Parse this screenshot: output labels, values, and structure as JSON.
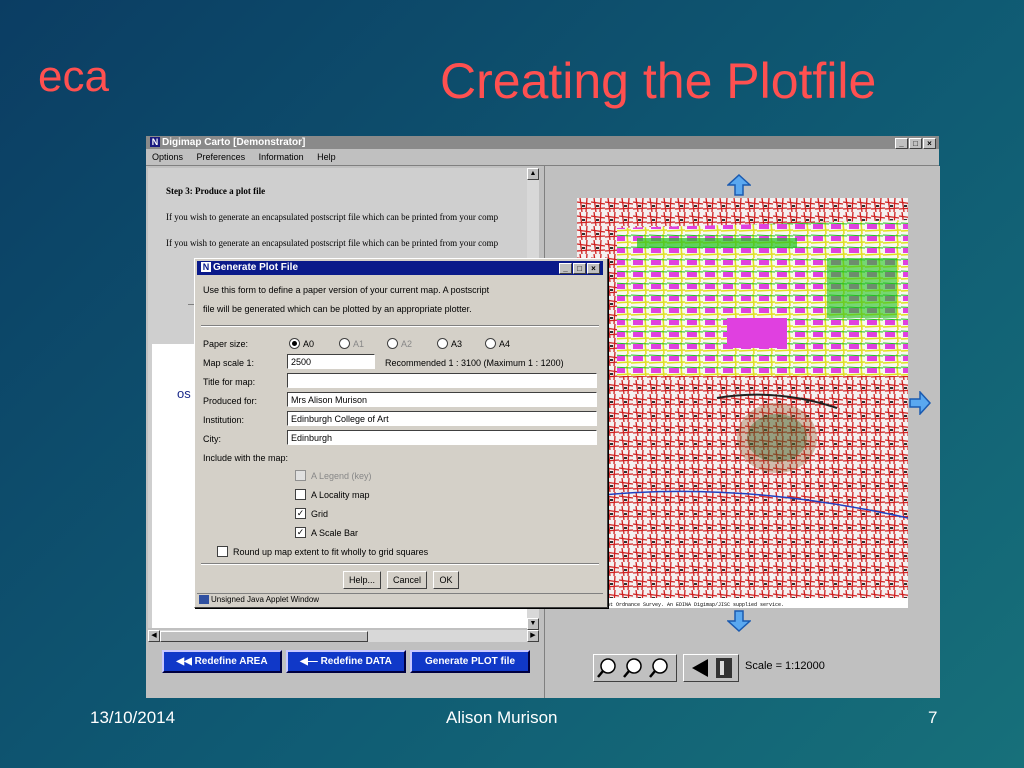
{
  "slide": {
    "logo": "eca",
    "title": "Creating the Plotfile",
    "footer_date": "13/10/2014",
    "footer_author": "Alison Murison",
    "footer_page": "7"
  },
  "app": {
    "window_title": "Digimap Carto [Demonstrator]",
    "menu": [
      "Options",
      "Preferences",
      "Information",
      "Help"
    ],
    "step_heading": "Step 3: Produce a plot file",
    "step_text": "If you wish to generate an encapsulated postscript file which can be printed from your comp",
    "step_text_2": "If you wish to generate an encapsulated postscript file which can be printed from your comp",
    "partial_label": "os",
    "bottom_buttons": [
      "◀◀ Redefine AREA",
      "◀— Redefine DATA",
      "Generate PLOT file"
    ],
    "scale_label": "Scale = 1:12000",
    "map_copyright": "n Copyright Ordnance Survey. An EDINA Digimap/JISC supplied service."
  },
  "dialog": {
    "title": "Generate Plot File",
    "intro_line1": "Use this form to define a paper version of your current map.  A postscript",
    "intro_line2": "file will be generated which can be plotted by an appropriate plotter.",
    "paper_size_label": "Paper size:",
    "paper_sizes": [
      "A0",
      "A1",
      "A2",
      "A3",
      "A4"
    ],
    "paper_size_selected": "A0",
    "map_scale_label": "Map scale 1:",
    "map_scale_value": "2500",
    "recommended": "Recommended 1 : 3100 (Maximum 1 : 1200)",
    "title_label": "Title for map:",
    "title_value": "",
    "produced_label": "Produced for:",
    "produced_value": "Mrs Alison Murison",
    "institution_label": "Institution:",
    "institution_value": "Edinburgh College of Art",
    "city_label": "City:",
    "city_value": "Edinburgh",
    "include_label": "Include with the map:",
    "options": [
      {
        "label": "A Legend (key)",
        "checked": false,
        "disabled": true
      },
      {
        "label": "A Locality map",
        "checked": false,
        "disabled": false
      },
      {
        "label": "Grid",
        "checked": true,
        "disabled": false
      },
      {
        "label": "A Scale Bar",
        "checked": true,
        "disabled": false
      }
    ],
    "round_up_label": "Round up map extent to fit wholly to grid squares",
    "round_up_checked": false,
    "help_button": "Help...",
    "cancel_button": "Cancel",
    "ok_button": "OK",
    "status": "Unsigned Java Applet Window"
  }
}
